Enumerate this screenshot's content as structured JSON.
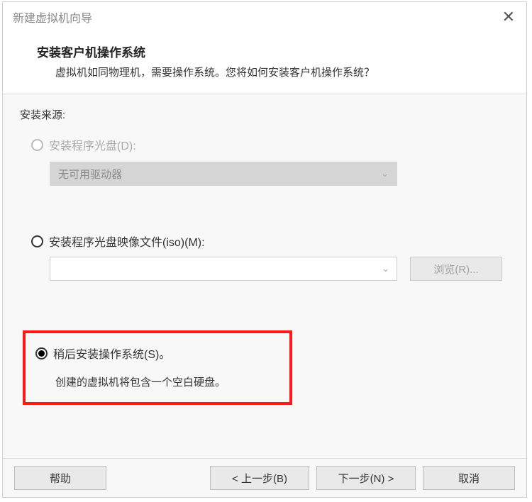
{
  "window": {
    "title": "新建虚拟机向导"
  },
  "header": {
    "title": "安装客户机操作系统",
    "subtitle": "虚拟机如同物理机，需要操作系统。您将如何安装客户机操作系统？"
  },
  "section_label": "安装来源:",
  "options": {
    "disc": {
      "label": "安装程序光盘(D):",
      "drive_text": "无可用驱动器"
    },
    "iso": {
      "label": "安装程序光盘映像文件(iso)(M):",
      "browse": "浏览(R)..."
    },
    "later": {
      "label": "稍后安装操作系统(S)。",
      "description": "创建的虚拟机将包含一个空白硬盘。"
    }
  },
  "footer": {
    "help": "帮助",
    "back": "< 上一步(B)",
    "next": "下一步(N) >",
    "cancel": "取消"
  }
}
